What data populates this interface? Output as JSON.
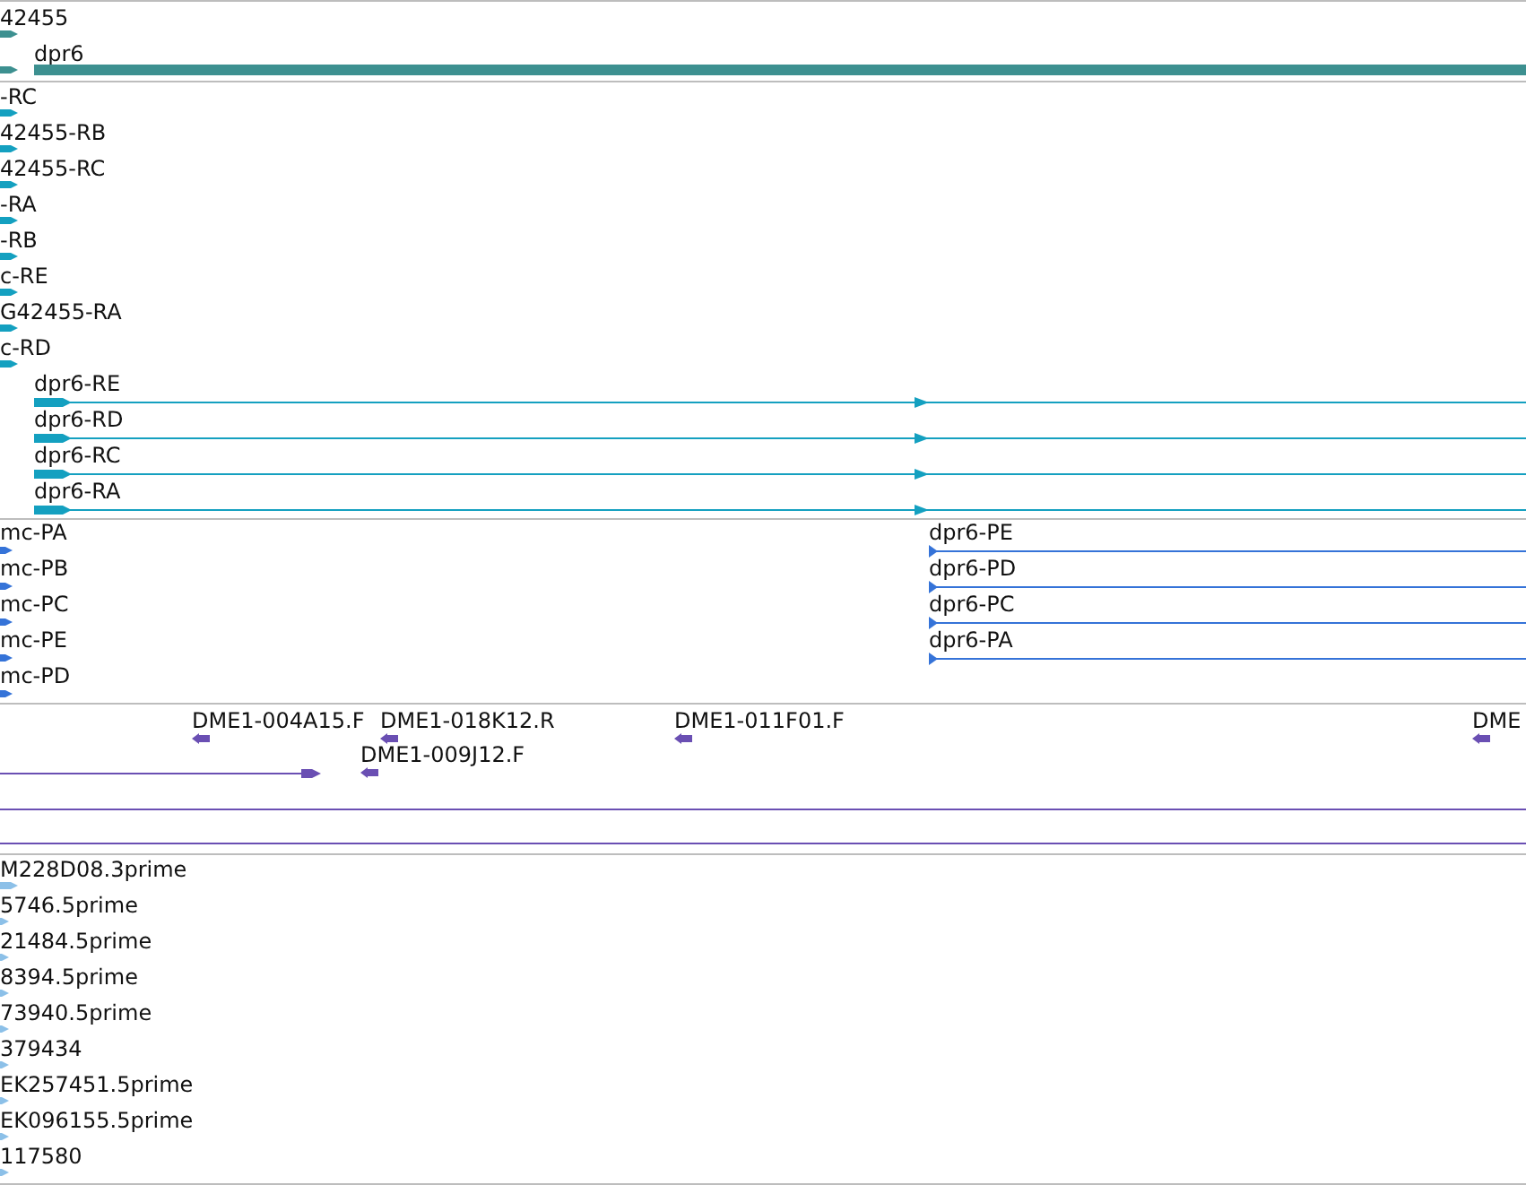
{
  "tracks": [
    {
      "kind": "gene",
      "color": "#3d9090",
      "features": [
        {
          "label": "42455"
        },
        {
          "label": "dpr6"
        }
      ]
    },
    {
      "kind": "transcript",
      "color": "#14a0c0",
      "features": [
        {
          "label": "-RC"
        },
        {
          "label": "42455-RB"
        },
        {
          "label": "42455-RC"
        },
        {
          "label": "-RA"
        },
        {
          "label": "-RB"
        },
        {
          "label": "c-RE"
        },
        {
          "label": "G42455-RA"
        },
        {
          "label": "c-RD"
        },
        {
          "label": "dpr6-RE"
        },
        {
          "label": "dpr6-RD"
        },
        {
          "label": "dpr6-RC"
        },
        {
          "label": "dpr6-RA"
        }
      ]
    },
    {
      "kind": "protein",
      "color": "#3573d8",
      "features": [
        {
          "label": "mc-PA"
        },
        {
          "label": "mc-PB"
        },
        {
          "label": "mc-PC"
        },
        {
          "label": "mc-PE"
        },
        {
          "label": "mc-PD"
        },
        {
          "label": "dpr6-PE"
        },
        {
          "label": "dpr6-PD"
        },
        {
          "label": "dpr6-PC"
        },
        {
          "label": "dpr6-PA"
        }
      ]
    },
    {
      "kind": "clone",
      "color": "#6a4fb3",
      "features": [
        {
          "label": "DME1-004A15.F"
        },
        {
          "label": "DME1-018K12.R"
        },
        {
          "label": "DME1-011F01.F"
        },
        {
          "label": "DME"
        },
        {
          "label": "DME1-009J12.F"
        }
      ]
    },
    {
      "kind": "est",
      "color": "#8cc0e8",
      "features": [
        {
          "label": "M228D08.3prime"
        },
        {
          "label": "5746.5prime"
        },
        {
          "label": "21484.5prime"
        },
        {
          "label": "8394.5prime"
        },
        {
          "label": "73940.5prime"
        },
        {
          "label": "379434"
        },
        {
          "label": "EK257451.5prime"
        },
        {
          "label": "EK096155.5prime"
        },
        {
          "label": "117580"
        }
      ]
    }
  ]
}
